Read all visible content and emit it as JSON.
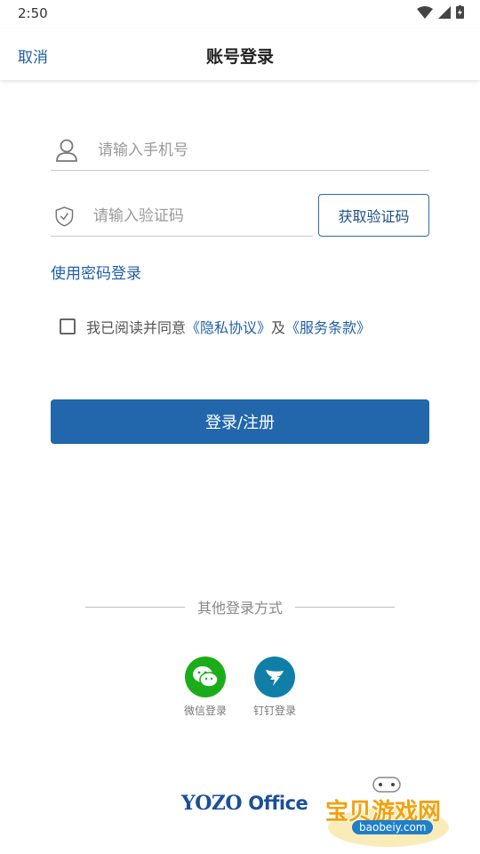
{
  "status_bar": {
    "time": "2:50"
  },
  "header": {
    "cancel_label": "取消",
    "title": "账号登录"
  },
  "form": {
    "phone_placeholder": "请输入手机号",
    "code_placeholder": "请输入验证码",
    "get_code_label": "获取验证码",
    "password_login_label": "使用密码登录"
  },
  "agreement": {
    "prefix": "我已阅读并同意",
    "privacy": "《隐私协议》",
    "and": "及",
    "terms": "《服务条款》"
  },
  "login_button_label": "登录/注册",
  "other_login": {
    "title": "其他登录方式",
    "options": [
      {
        "label": "微信登录",
        "icon": "wechat-icon",
        "color": "#1aad19"
      },
      {
        "label": "钉钉登录",
        "icon": "dingtalk-icon",
        "color": "#0f7fa8"
      }
    ]
  },
  "footer": {
    "brand_yozo": "YOZO",
    "brand_office": "Office",
    "watermark_text": "宝贝游戏网",
    "watermark_url": "baobeiy.com"
  },
  "colors": {
    "accent": "#2267ac",
    "link": "#1f5fa5"
  }
}
